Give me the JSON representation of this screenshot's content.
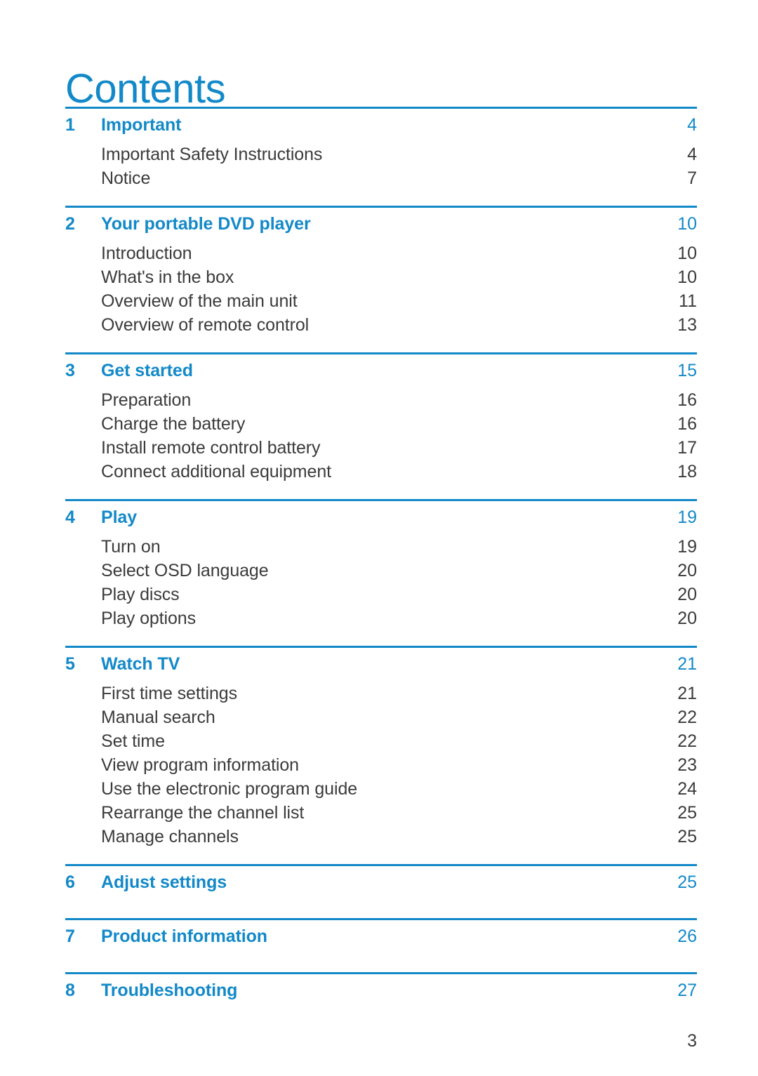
{
  "document": {
    "title": "Contents",
    "accent_color": "#1389c8",
    "body_text_color": "#3b3b3b",
    "folio": "3"
  },
  "toc": {
    "sections": [
      {
        "number": "1",
        "title": "Important",
        "page": "4",
        "subitems": [
          {
            "title": "Important Safety Instructions",
            "page": "4"
          },
          {
            "title": "Notice",
            "page": "7"
          }
        ]
      },
      {
        "number": "2",
        "title": "Your portable DVD player",
        "page": "10",
        "subitems": [
          {
            "title": "Introduction",
            "page": "10"
          },
          {
            "title": "What's in the box",
            "page": "10"
          },
          {
            "title": "Overview of the main unit",
            "page": "11"
          },
          {
            "title": "Overview of remote control",
            "page": "13"
          }
        ]
      },
      {
        "number": "3",
        "title": "Get started",
        "page": "15",
        "subitems": [
          {
            "title": "Preparation",
            "page": "16"
          },
          {
            "title": "Charge the battery",
            "page": "16"
          },
          {
            "title": "Install remote control battery",
            "page": "17"
          },
          {
            "title": "Connect additional equipment",
            "page": "18"
          }
        ]
      },
      {
        "number": "4",
        "title": "Play",
        "page": "19",
        "subitems": [
          {
            "title": "Turn on",
            "page": "19"
          },
          {
            "title": "Select OSD language",
            "page": "20"
          },
          {
            "title": "Play discs",
            "page": "20"
          },
          {
            "title": "Play options",
            "page": "20"
          }
        ]
      },
      {
        "number": "5",
        "title": "Watch TV",
        "page": "21",
        "subitems": [
          {
            "title": "First time settings",
            "page": "21"
          },
          {
            "title": "Manual search",
            "page": "22"
          },
          {
            "title": "Set time",
            "page": "22"
          },
          {
            "title": "View program information",
            "page": "23"
          },
          {
            "title": "Use the electronic program guide",
            "page": "24"
          },
          {
            "title": "Rearrange the channel list",
            "page": "25"
          },
          {
            "title": "Manage channels",
            "page": "25"
          }
        ]
      },
      {
        "number": "6",
        "title": "Adjust settings",
        "page": "25",
        "subitems": []
      },
      {
        "number": "7",
        "title": "Product information",
        "page": "26",
        "subitems": []
      },
      {
        "number": "8",
        "title": "Troubleshooting",
        "page": "27",
        "subitems": []
      }
    ]
  }
}
